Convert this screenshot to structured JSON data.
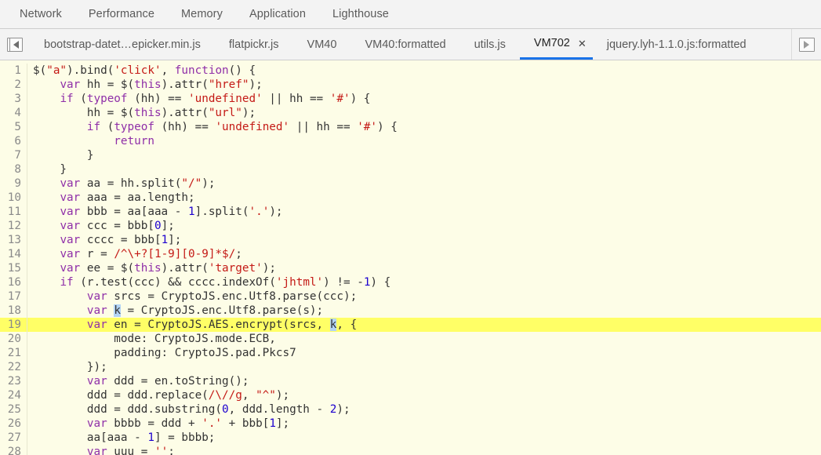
{
  "panel_tabs": [
    {
      "label": "Network",
      "active": false
    },
    {
      "label": "Performance",
      "active": false
    },
    {
      "label": "Memory",
      "active": false
    },
    {
      "label": "Application",
      "active": false
    },
    {
      "label": "Lighthouse",
      "active": false
    }
  ],
  "file_tabs": {
    "navigator_toggle_icon": "show-navigator-icon",
    "scroll_right_icon": "scroll-tabs-right-icon",
    "close_label": "✕",
    "items": [
      {
        "label": "bootstrap-datet…epicker.min.js",
        "active": false,
        "closable": false
      },
      {
        "label": "flatpickr.js",
        "active": false,
        "closable": false
      },
      {
        "label": "VM40",
        "active": false,
        "closable": false
      },
      {
        "label": "VM40:formatted",
        "active": false,
        "closable": false
      },
      {
        "label": "utils.js",
        "active": false,
        "closable": false
      },
      {
        "label": "VM702",
        "active": true,
        "closable": true
      },
      {
        "label": "jquery.lyh-1.1.0.js:formatted",
        "active": false,
        "closable": false
      }
    ]
  },
  "colors": {
    "editor_background": "#fdfde7",
    "highlight_line": "#ffff66",
    "keyword": "#8f2fa8",
    "string": "#c41a16",
    "number": "#1c00cf",
    "plain": "#333333",
    "selection": "#b3d4f5",
    "active_tab_underline": "#1a73e8",
    "chrome_background": "#f3f3f3"
  },
  "editor": {
    "highlighted_line": 19,
    "lines": [
      {
        "n": 1,
        "tokens": [
          {
            "t": "$(",
            "c": "plain"
          },
          {
            "t": "\"a\"",
            "c": "str"
          },
          {
            "t": ").bind(",
            "c": "plain"
          },
          {
            "t": "'click'",
            "c": "str"
          },
          {
            "t": ", ",
            "c": "plain"
          },
          {
            "t": "function",
            "c": "kw"
          },
          {
            "t": "() {",
            "c": "plain"
          }
        ]
      },
      {
        "n": 2,
        "tokens": [
          {
            "t": "    ",
            "c": "plain"
          },
          {
            "t": "var",
            "c": "kw"
          },
          {
            "t": " hh = $(",
            "c": "plain"
          },
          {
            "t": "this",
            "c": "kw"
          },
          {
            "t": ").attr(",
            "c": "plain"
          },
          {
            "t": "\"href\"",
            "c": "str"
          },
          {
            "t": ");",
            "c": "plain"
          }
        ]
      },
      {
        "n": 3,
        "tokens": [
          {
            "t": "    ",
            "c": "plain"
          },
          {
            "t": "if",
            "c": "kw"
          },
          {
            "t": " (",
            "c": "plain"
          },
          {
            "t": "typeof",
            "c": "kw"
          },
          {
            "t": " (hh) == ",
            "c": "plain"
          },
          {
            "t": "'undefined'",
            "c": "str"
          },
          {
            "t": " || hh == ",
            "c": "plain"
          },
          {
            "t": "'#'",
            "c": "str"
          },
          {
            "t": ") {",
            "c": "plain"
          }
        ]
      },
      {
        "n": 4,
        "tokens": [
          {
            "t": "        hh = $(",
            "c": "plain"
          },
          {
            "t": "this",
            "c": "kw"
          },
          {
            "t": ").attr(",
            "c": "plain"
          },
          {
            "t": "\"url\"",
            "c": "str"
          },
          {
            "t": ");",
            "c": "plain"
          }
        ]
      },
      {
        "n": 5,
        "tokens": [
          {
            "t": "        ",
            "c": "plain"
          },
          {
            "t": "if",
            "c": "kw"
          },
          {
            "t": " (",
            "c": "plain"
          },
          {
            "t": "typeof",
            "c": "kw"
          },
          {
            "t": " (hh) == ",
            "c": "plain"
          },
          {
            "t": "'undefined'",
            "c": "str"
          },
          {
            "t": " || hh == ",
            "c": "plain"
          },
          {
            "t": "'#'",
            "c": "str"
          },
          {
            "t": ") {",
            "c": "plain"
          }
        ]
      },
      {
        "n": 6,
        "tokens": [
          {
            "t": "            ",
            "c": "plain"
          },
          {
            "t": "return",
            "c": "kw"
          }
        ]
      },
      {
        "n": 7,
        "tokens": [
          {
            "t": "        }",
            "c": "plain"
          }
        ]
      },
      {
        "n": 8,
        "tokens": [
          {
            "t": "    }",
            "c": "plain"
          }
        ]
      },
      {
        "n": 9,
        "tokens": [
          {
            "t": "    ",
            "c": "plain"
          },
          {
            "t": "var",
            "c": "kw"
          },
          {
            "t": " aa = hh.split(",
            "c": "plain"
          },
          {
            "t": "\"/\"",
            "c": "str"
          },
          {
            "t": ");",
            "c": "plain"
          }
        ]
      },
      {
        "n": 10,
        "tokens": [
          {
            "t": "    ",
            "c": "plain"
          },
          {
            "t": "var",
            "c": "kw"
          },
          {
            "t": " aaa = aa.length;",
            "c": "plain"
          }
        ]
      },
      {
        "n": 11,
        "tokens": [
          {
            "t": "    ",
            "c": "plain"
          },
          {
            "t": "var",
            "c": "kw"
          },
          {
            "t": " bbb = aa[aaa - ",
            "c": "plain"
          },
          {
            "t": "1",
            "c": "num"
          },
          {
            "t": "].split(",
            "c": "plain"
          },
          {
            "t": "'.'",
            "c": "str"
          },
          {
            "t": ");",
            "c": "plain"
          }
        ]
      },
      {
        "n": 12,
        "tokens": [
          {
            "t": "    ",
            "c": "plain"
          },
          {
            "t": "var",
            "c": "kw"
          },
          {
            "t": " ccc = bbb[",
            "c": "plain"
          },
          {
            "t": "0",
            "c": "num"
          },
          {
            "t": "];",
            "c": "plain"
          }
        ]
      },
      {
        "n": 13,
        "tokens": [
          {
            "t": "    ",
            "c": "plain"
          },
          {
            "t": "var",
            "c": "kw"
          },
          {
            "t": " cccc = bbb[",
            "c": "plain"
          },
          {
            "t": "1",
            "c": "num"
          },
          {
            "t": "];",
            "c": "plain"
          }
        ]
      },
      {
        "n": 14,
        "tokens": [
          {
            "t": "    ",
            "c": "plain"
          },
          {
            "t": "var",
            "c": "kw"
          },
          {
            "t": " r = ",
            "c": "plain"
          },
          {
            "t": "/^\\+?[1-9][0-9]*$/",
            "c": "str"
          },
          {
            "t": ";",
            "c": "plain"
          }
        ]
      },
      {
        "n": 15,
        "tokens": [
          {
            "t": "    ",
            "c": "plain"
          },
          {
            "t": "var",
            "c": "kw"
          },
          {
            "t": " ee = $(",
            "c": "plain"
          },
          {
            "t": "this",
            "c": "kw"
          },
          {
            "t": ").attr(",
            "c": "plain"
          },
          {
            "t": "'target'",
            "c": "str"
          },
          {
            "t": ");",
            "c": "plain"
          }
        ]
      },
      {
        "n": 16,
        "tokens": [
          {
            "t": "    ",
            "c": "plain"
          },
          {
            "t": "if",
            "c": "kw"
          },
          {
            "t": " (r.test(ccc) && cccc.indexOf(",
            "c": "plain"
          },
          {
            "t": "'jhtml'",
            "c": "str"
          },
          {
            "t": ") != -",
            "c": "plain"
          },
          {
            "t": "1",
            "c": "num"
          },
          {
            "t": ") {",
            "c": "plain"
          }
        ]
      },
      {
        "n": 17,
        "tokens": [
          {
            "t": "        ",
            "c": "plain"
          },
          {
            "t": "var",
            "c": "kw"
          },
          {
            "t": " srcs = CryptoJS.enc.Utf8.parse(ccc);",
            "c": "plain"
          }
        ]
      },
      {
        "n": 18,
        "tokens": [
          {
            "t": "        ",
            "c": "plain"
          },
          {
            "t": "var",
            "c": "kw"
          },
          {
            "t": " ",
            "c": "plain"
          },
          {
            "t": "k",
            "c": "sel"
          },
          {
            "t": " = CryptoJS.enc.Utf8.parse(s);",
            "c": "plain"
          }
        ]
      },
      {
        "n": 19,
        "tokens": [
          {
            "t": "        ",
            "c": "plain"
          },
          {
            "t": "var",
            "c": "kw"
          },
          {
            "t": " en = CryptoJS.AES.encrypt(srcs, ",
            "c": "plain"
          },
          {
            "t": "k",
            "c": "sel"
          },
          {
            "t": ", {",
            "c": "plain"
          }
        ]
      },
      {
        "n": 20,
        "tokens": [
          {
            "t": "            mode: CryptoJS.mode.ECB,",
            "c": "plain"
          }
        ]
      },
      {
        "n": 21,
        "tokens": [
          {
            "t": "            padding: CryptoJS.pad.Pkcs7",
            "c": "plain"
          }
        ]
      },
      {
        "n": 22,
        "tokens": [
          {
            "t": "        });",
            "c": "plain"
          }
        ]
      },
      {
        "n": 23,
        "tokens": [
          {
            "t": "        ",
            "c": "plain"
          },
          {
            "t": "var",
            "c": "kw"
          },
          {
            "t": " ddd = en.toString();",
            "c": "plain"
          }
        ]
      },
      {
        "n": 24,
        "tokens": [
          {
            "t": "        ddd = ddd.replace(",
            "c": "plain"
          },
          {
            "t": "/\\//g",
            "c": "str"
          },
          {
            "t": ", ",
            "c": "plain"
          },
          {
            "t": "\"^\"",
            "c": "str"
          },
          {
            "t": ");",
            "c": "plain"
          }
        ]
      },
      {
        "n": 25,
        "tokens": [
          {
            "t": "        ddd = ddd.substring(",
            "c": "plain"
          },
          {
            "t": "0",
            "c": "num"
          },
          {
            "t": ", ddd.length - ",
            "c": "plain"
          },
          {
            "t": "2",
            "c": "num"
          },
          {
            "t": ");",
            "c": "plain"
          }
        ]
      },
      {
        "n": 26,
        "tokens": [
          {
            "t": "        ",
            "c": "plain"
          },
          {
            "t": "var",
            "c": "kw"
          },
          {
            "t": " bbbb = ddd + ",
            "c": "plain"
          },
          {
            "t": "'.'",
            "c": "str"
          },
          {
            "t": " + bbb[",
            "c": "plain"
          },
          {
            "t": "1",
            "c": "num"
          },
          {
            "t": "];",
            "c": "plain"
          }
        ]
      },
      {
        "n": 27,
        "tokens": [
          {
            "t": "        aa[aaa - ",
            "c": "plain"
          },
          {
            "t": "1",
            "c": "num"
          },
          {
            "t": "] = bbbb;",
            "c": "plain"
          }
        ]
      },
      {
        "n": 28,
        "tokens": [
          {
            "t": "        ",
            "c": "plain"
          },
          {
            "t": "var",
            "c": "kw"
          },
          {
            "t": " uuu = ",
            "c": "plain"
          },
          {
            "t": "''",
            "c": "str"
          },
          {
            "t": ";",
            "c": "plain"
          }
        ]
      }
    ]
  }
}
